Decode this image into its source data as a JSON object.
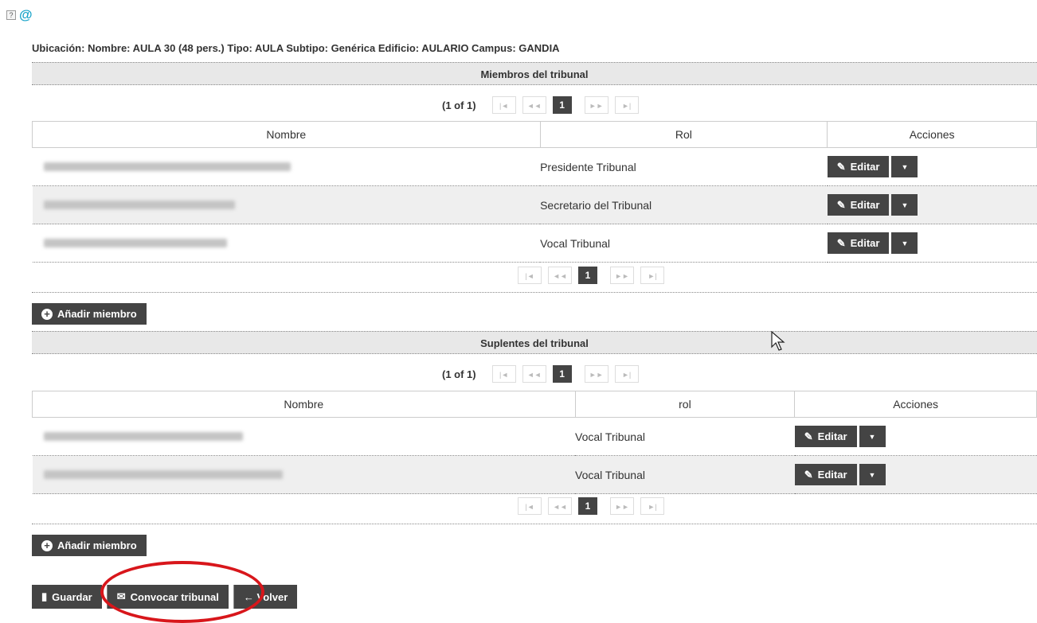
{
  "top_icons": {
    "help": "?",
    "at": "@"
  },
  "ubicacion": "Ubicación: Nombre: AULA 30 (48 pers.) Tipo: AULA Subtipo: Genérica Edificio: AULARIO Campus: GANDIA",
  "miembros": {
    "title": "Miembros del tribunal",
    "pager": {
      "count": "(1 of 1)",
      "first": "|◄",
      "prev": "◄◄",
      "page": "1",
      "next": "►►",
      "last": "►|"
    },
    "headers": {
      "nombre": "Nombre",
      "rol": "Rol",
      "acciones": "Acciones"
    },
    "rows": [
      {
        "rol": "Presidente Tribunal",
        "edit": "Editar"
      },
      {
        "rol": "Secretario del Tribunal",
        "edit": "Editar"
      },
      {
        "rol": "Vocal Tribunal",
        "edit": "Editar"
      }
    ],
    "add_button": "Añadir miembro"
  },
  "suplentes": {
    "title": "Suplentes del tribunal",
    "pager": {
      "count": "(1 of 1)",
      "first": "|◄",
      "prev": "◄◄",
      "page": "1",
      "next": "►►",
      "last": "►|"
    },
    "headers": {
      "nombre": "Nombre",
      "rol": "rol",
      "acciones": "Acciones"
    },
    "rows": [
      {
        "rol": "Vocal Tribunal",
        "edit": "Editar"
      },
      {
        "rol": "Vocal Tribunal",
        "edit": "Editar"
      }
    ],
    "add_button": "Añadir miembro"
  },
  "footer": {
    "guardar": "Guardar",
    "convocar": "Convocar tribunal",
    "volver": "← Volver"
  },
  "colors": {
    "button_bg": "#444444",
    "highlight_circle": "#d8161b",
    "section_bg": "#e8e8e8"
  }
}
